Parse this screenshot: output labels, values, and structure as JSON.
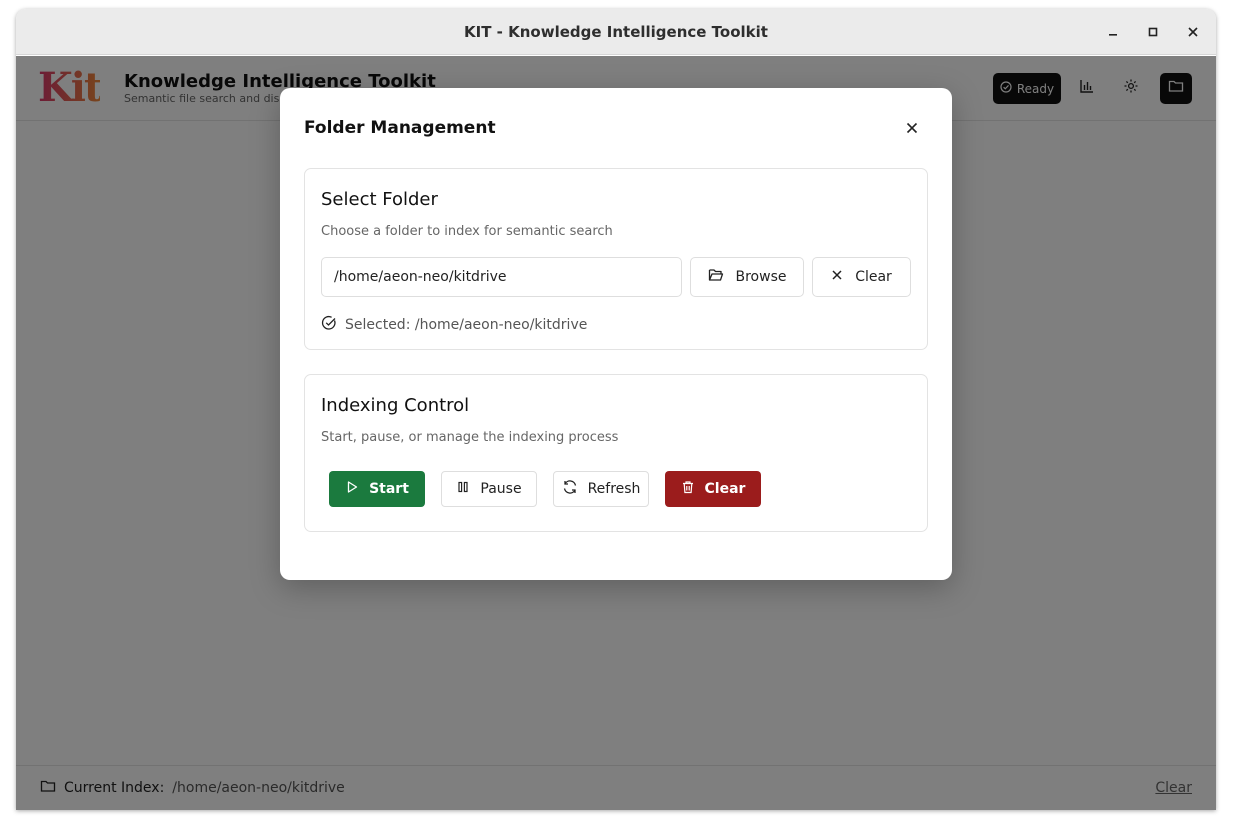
{
  "window": {
    "title": "KIT - Knowledge Intelligence Toolkit"
  },
  "header": {
    "logo_text": "Kit",
    "title": "Knowledge Intelligence Toolkit",
    "subtitle": "Semantic file search and discovery",
    "status_label": "Ready",
    "icons": [
      "check-circle-icon",
      "bar-chart-icon",
      "gear-icon",
      "folder-icon"
    ]
  },
  "footer": {
    "label": "Current Index:",
    "path": "/home/aeon-neo/kitdrive",
    "clear_label": "Clear"
  },
  "modal": {
    "title": "Folder Management",
    "select_folder": {
      "title": "Select Folder",
      "description": "Choose a folder to index for semantic search",
      "input_value": "/home/aeon-neo/kitdrive",
      "browse_label": "Browse",
      "clear_label": "Clear",
      "selected_text": "Selected: /home/aeon-neo/kitdrive"
    },
    "indexing": {
      "title": "Indexing Control",
      "description": "Start, pause, or manage the indexing process",
      "start_label": "Start",
      "pause_label": "Pause",
      "refresh_label": "Refresh",
      "clear_label": "Clear"
    }
  },
  "colors": {
    "start_button": "#1b7a3e",
    "clear_button": "#9b1c1c",
    "overlay": "rgba(0,0,0,0.5)",
    "dark_button": "#111111"
  }
}
